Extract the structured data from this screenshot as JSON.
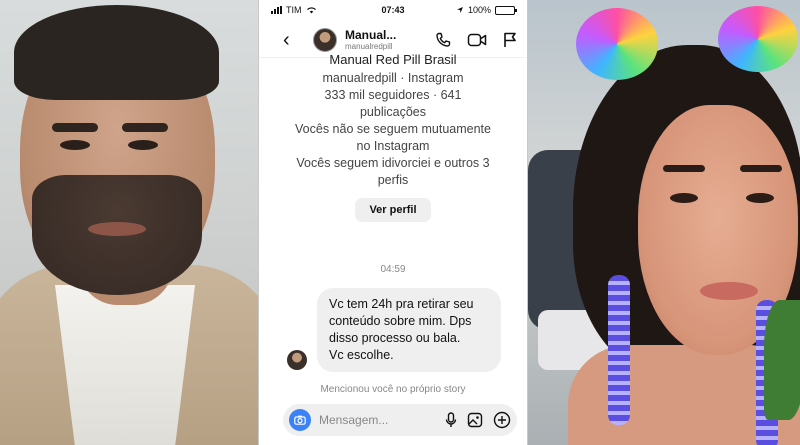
{
  "status_bar": {
    "carrier": "TIM",
    "time": "07:43",
    "battery": "100%",
    "battery_level": 1.0
  },
  "header": {
    "display_name": "Manual...",
    "handle": "manualredpill"
  },
  "profile": {
    "name": "Manual Red Pill Brasil",
    "meta": "manualredpill · Instagram",
    "stats_line1": "333 mil seguidores · 641",
    "stats_line2": "publicações",
    "mutual_line1": "Vocês não se seguem mutuamente",
    "mutual_line2": "no Instagram",
    "follows_line1": "Vocês seguem idivorciei e outros 3",
    "follows_line2": "perfis",
    "view_profile": "Ver perfil"
  },
  "chat": {
    "timestamp": "04:59",
    "message_lines": [
      "Vc tem 24h pra retirar seu",
      "conteúdo sobre mim. Dps",
      "disso processo ou bala.",
      "Vc escolhe."
    ],
    "mention_note": "Mencionou você no próprio story"
  },
  "composer": {
    "placeholder": "Mensagem..."
  },
  "colors": {
    "camera_button": "#3b82f6",
    "bubble": "#efefef"
  },
  "icons": [
    "back-icon",
    "phone-icon",
    "video-icon",
    "flag-icon",
    "camera-icon",
    "mic-icon",
    "gallery-icon",
    "plus-icon"
  ]
}
